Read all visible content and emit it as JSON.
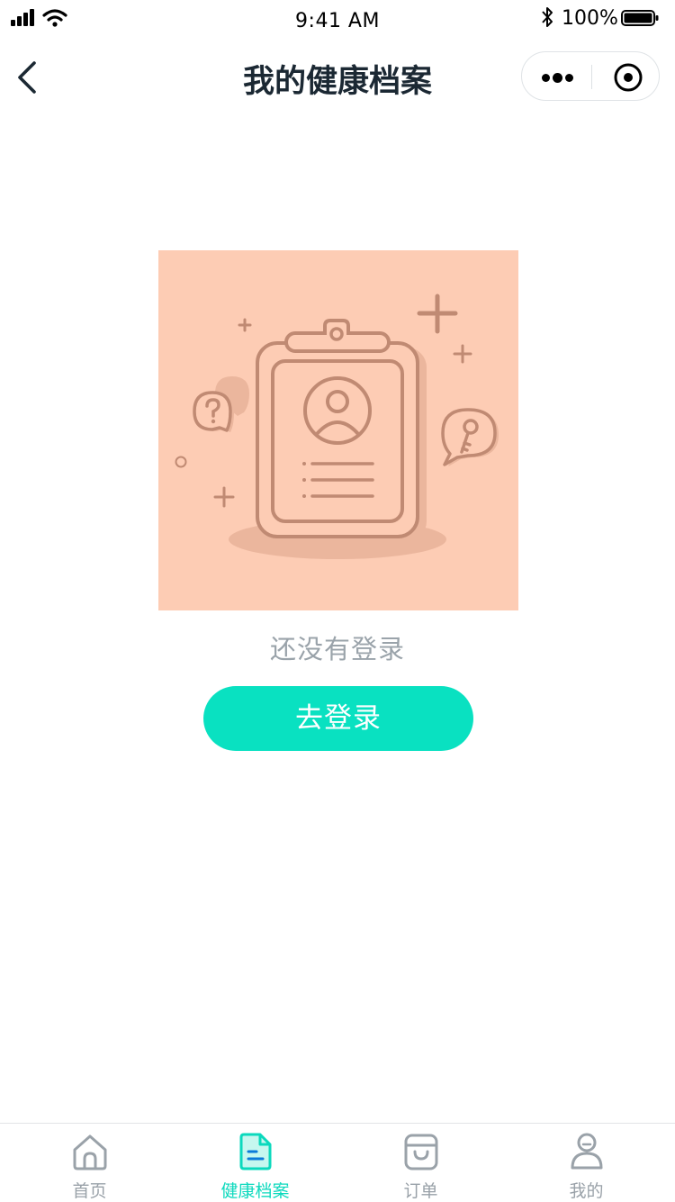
{
  "status_bar": {
    "time": "9:41 AM",
    "battery": "100%"
  },
  "nav": {
    "title": "我的健康档案"
  },
  "empty_state": {
    "illustration": "id-badge-clipboard-illustration",
    "message": "还没有登录",
    "button_label": "去登录"
  },
  "tabs": [
    {
      "label": "首页",
      "icon": "home-icon",
      "active": false
    },
    {
      "label": "健康档案",
      "icon": "health-record-icon",
      "active": true
    },
    {
      "label": "订单",
      "icon": "order-bag-icon",
      "active": false
    },
    {
      "label": "我的",
      "icon": "user-icon",
      "active": false
    }
  ],
  "colors": {
    "accent": "#09e1c1",
    "illustration_bg": "#fdccb4",
    "illustration_line": "#c08a73",
    "tab_inactive": "#99a1a8",
    "tab_active": "#0bd9bd"
  }
}
